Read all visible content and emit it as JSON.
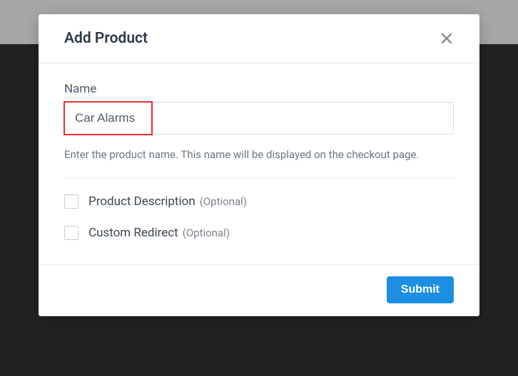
{
  "modal": {
    "title": "Add Product",
    "name_field": {
      "label": "Name",
      "value": "Car Alarms",
      "help_text": "Enter the product name. This name will be displayed on the checkout page."
    },
    "options": {
      "product_description": {
        "label": "Product Description",
        "suffix": "(Optional)"
      },
      "custom_redirect": {
        "label": "Custom Redirect",
        "suffix": "(Optional)"
      }
    },
    "submit_label": "Submit"
  }
}
